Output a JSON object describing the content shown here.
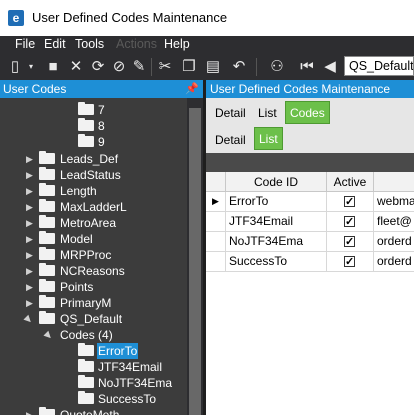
{
  "window": {
    "title": "User Defined Codes Maintenance",
    "app_icon": "e"
  },
  "menu": [
    "File",
    "Edit",
    "Tools",
    "Actions",
    "Help"
  ],
  "toolbar": {
    "combo_value": "QS_Default"
  },
  "left_panel": {
    "title": "User Codes",
    "tree": [
      {
        "label": "7",
        "level": "leaf"
      },
      {
        "label": "8",
        "level": "leaf"
      },
      {
        "label": "9",
        "level": "leaf"
      },
      {
        "label": "Leads_Def",
        "level": "folder"
      },
      {
        "label": "LeadStatus",
        "level": "folder"
      },
      {
        "label": "Length",
        "level": "folder"
      },
      {
        "label": "MaxLadderL",
        "level": "folder"
      },
      {
        "label": "MetroArea",
        "level": "folder"
      },
      {
        "label": "Model",
        "level": "folder"
      },
      {
        "label": "MRPProc",
        "level": "folder"
      },
      {
        "label": "NCReasons",
        "level": "folder"
      },
      {
        "label": "Points",
        "level": "folder"
      },
      {
        "label": "PrimaryM",
        "level": "folder"
      },
      {
        "label": "QS_Default",
        "level": "folder-open"
      },
      {
        "label": "Codes (4)",
        "level": "group"
      },
      {
        "label": "ErrorTo",
        "level": "code",
        "selected": true
      },
      {
        "label": "JTF34Email",
        "level": "code"
      },
      {
        "label": "NoJTF34Ema",
        "level": "code"
      },
      {
        "label": "SuccessTo",
        "level": "code"
      },
      {
        "label": "QuoteMeth",
        "level": "folder"
      }
    ]
  },
  "right_panel": {
    "title": "User Defined Codes Maintenance",
    "tabs_top": [
      "Detail",
      "List",
      "Codes"
    ],
    "tabs_sub": [
      "Detail",
      "List"
    ],
    "grid": {
      "columns": [
        "Code ID",
        "Active"
      ],
      "rows": [
        {
          "code": "ErrorTo",
          "active": true,
          "desc": "webma"
        },
        {
          "code": "JTF34Email",
          "active": true,
          "desc": "fleet@"
        },
        {
          "code": "NoJTF34Ema",
          "active": true,
          "desc": "orderd"
        },
        {
          "code": "SuccessTo",
          "active": true,
          "desc": "orderd"
        }
      ]
    }
  },
  "colors": {
    "accent": "#1e8fd6",
    "tab_active": "#6cc04a"
  }
}
